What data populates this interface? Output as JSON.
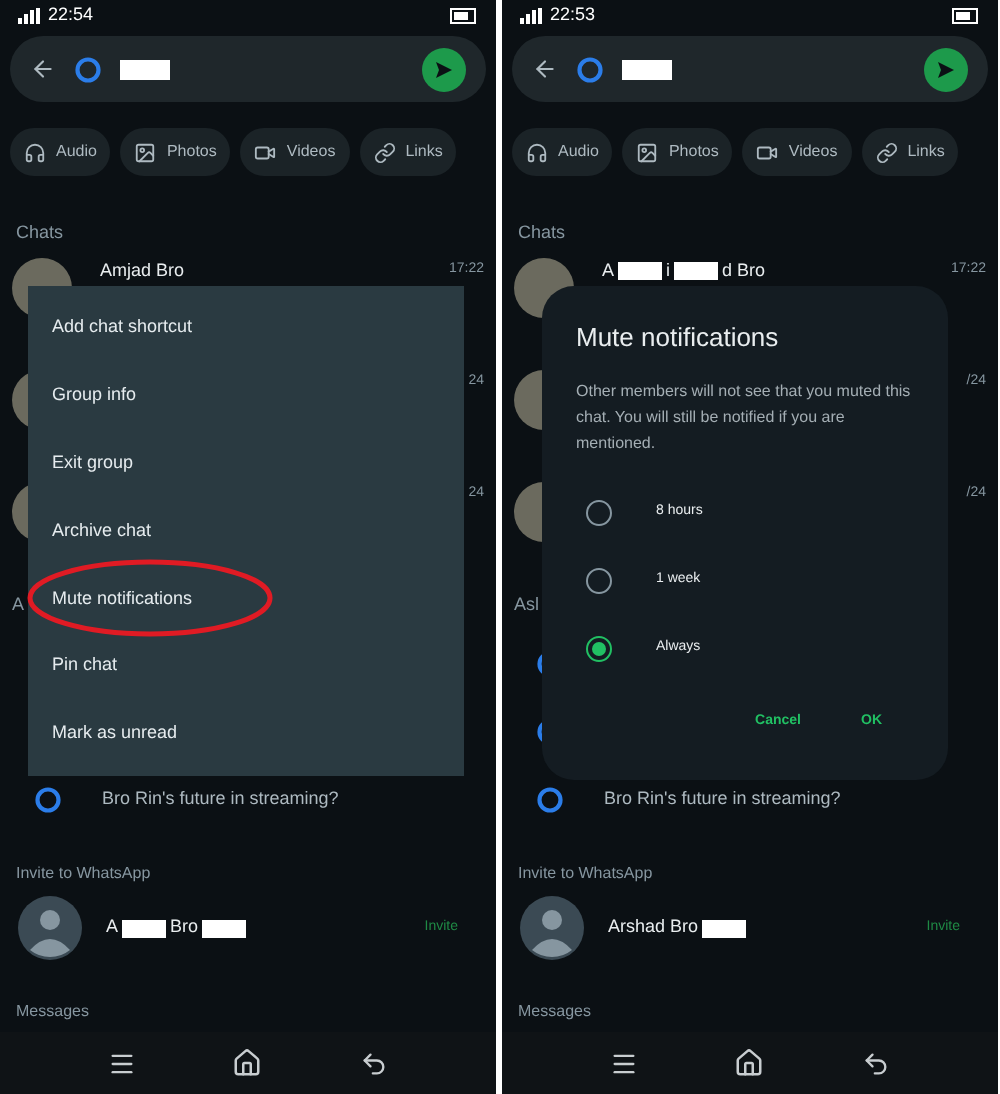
{
  "screens": [
    {
      "status_time": "22:54",
      "chips": [
        {
          "kind": "audio",
          "label": "Audio"
        },
        {
          "kind": "photos",
          "label": "Photos"
        },
        {
          "kind": "videos",
          "label": "Videos"
        },
        {
          "kind": "links",
          "label": "Links"
        }
      ],
      "chats_heading": "Chats",
      "chats": [
        {
          "name_parts": [
            "Amjad Bro"
          ],
          "time": "17:22"
        },
        {
          "time": "24"
        },
        {
          "time": "24"
        }
      ],
      "ai_heading": "A",
      "ai_rows": [
        {
          "kind": "covered"
        },
        {
          "kind": "covered"
        },
        {
          "kind": "prompt",
          "text": "Bro Rin's future in streaming?"
        }
      ],
      "invite_heading": "Invite to WhatsApp",
      "contact": {
        "name_parts": [
          "A",
          "Bro"
        ],
        "redacted_end": true,
        "action": "Invite"
      },
      "messages_heading": "Messages",
      "overlay": {
        "kind": "menu",
        "items": [
          {
            "label": "Add chat shortcut",
            "circled": false
          },
          {
            "label": "Group info",
            "circled": false
          },
          {
            "label": "Exit group",
            "circled": false
          },
          {
            "label": "Archive chat",
            "circled": false
          },
          {
            "label": "Mute notifications",
            "circled": true
          },
          {
            "label": "Pin chat",
            "circled": false
          },
          {
            "label": "Mark as unread",
            "circled": false
          }
        ]
      }
    },
    {
      "status_time": "22:53",
      "chips": [
        {
          "kind": "audio",
          "label": "Audio"
        },
        {
          "kind": "photos",
          "label": "Photos"
        },
        {
          "kind": "videos",
          "label": "Videos"
        },
        {
          "kind": "links",
          "label": "Links"
        }
      ],
      "chats_heading": "Chats",
      "chats": [
        {
          "name_parts": [
            "A",
            "i",
            "d Bro"
          ],
          "time": "17:22"
        },
        {
          "time": "/24"
        },
        {
          "time": "/24"
        }
      ],
      "ai_heading": "Asl",
      "ai_rows": [
        {
          "kind": "icon_only"
        },
        {
          "kind": "icon_only"
        },
        {
          "kind": "prompt",
          "text": "Bro Rin's future in streaming?"
        }
      ],
      "invite_heading": "Invite to WhatsApp",
      "contact": {
        "name_parts": [
          "Arshad Bro"
        ],
        "redacted_end": true,
        "action": "Invite"
      },
      "messages_heading": "Messages",
      "overlay": {
        "kind": "dialog",
        "title": "Mute notifications",
        "body": "Other members will not see that you muted this chat. You will still be notified if you are mentioned.",
        "options": [
          {
            "label": "8 hours",
            "selected": false
          },
          {
            "label": "1 week",
            "selected": false
          },
          {
            "label": "Always",
            "selected": true
          }
        ],
        "buttons": [
          "Cancel",
          "OK"
        ]
      }
    }
  ]
}
